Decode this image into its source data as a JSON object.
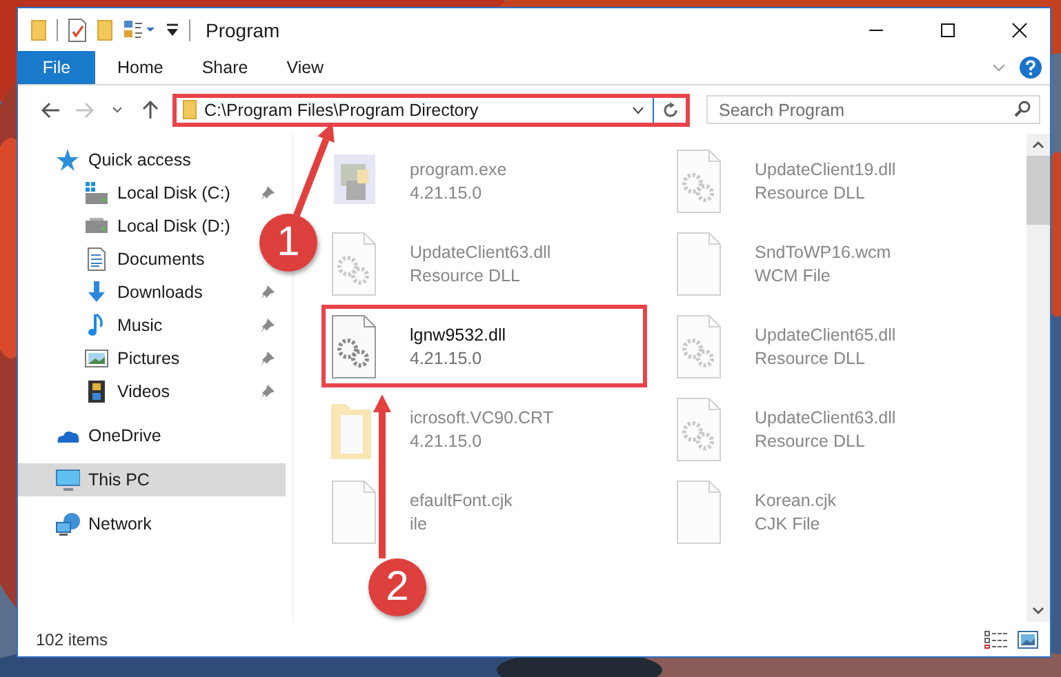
{
  "window": {
    "title": "Program"
  },
  "ribbon_tabs": [
    {
      "label": "File",
      "kind": "file"
    },
    {
      "label": "Home",
      "kind": "plain"
    },
    {
      "label": "Share",
      "kind": "plain"
    },
    {
      "label": "View",
      "kind": "plain"
    }
  ],
  "address_bar": {
    "path": "C:\\Program Files\\Program Directory",
    "highlighted": true
  },
  "search": {
    "placeholder": "Search Program"
  },
  "nav_items": [
    {
      "label": "Quick access",
      "kind": "star",
      "selected": false,
      "children": [
        {
          "label": "Local Disk (C:)",
          "kind": "systemdrive",
          "pinned": true,
          "selected": false
        },
        {
          "label": "Local Disk (D:)",
          "kind": "drive",
          "pinned": false,
          "selected": false
        },
        {
          "label": "Documents",
          "kind": "document",
          "pinned": false,
          "selected": false
        },
        {
          "label": "Downloads",
          "kind": "download",
          "pinned": true,
          "selected": false
        },
        {
          "label": "Music",
          "kind": "music",
          "pinned": true,
          "selected": false
        },
        {
          "label": "Pictures",
          "kind": "pictures",
          "pinned": true,
          "selected": false
        },
        {
          "label": "Videos",
          "kind": "film",
          "pinned": true,
          "selected": false
        }
      ]
    },
    {
      "label": "OneDrive",
      "kind": "cloud",
      "selected": false
    },
    {
      "label": "This PC",
      "kind": "monitor",
      "selected": true
    },
    {
      "label": "Network",
      "kind": "network",
      "selected": false
    }
  ],
  "files": [
    {
      "name": "program.exe",
      "detail": "4.21.15.0",
      "kind": "exe",
      "highlighted": false,
      "blurred": true
    },
    {
      "name": "UpdateClient19.dll",
      "detail": "Resource DLL",
      "kind": "gear",
      "highlighted": false,
      "blurred": true
    },
    {
      "name": "UpdateClient63.dll",
      "detail": "Resource DLL",
      "kind": "gear",
      "highlighted": false,
      "blurred": true
    },
    {
      "name": "SndToWP16.wcm",
      "detail": "WCM File",
      "kind": "blank",
      "highlighted": false,
      "blurred": true
    },
    {
      "name": "lgnw9532.dll",
      "detail": "4.21.15.0",
      "kind": "gear",
      "highlighted": true,
      "blurred": false
    },
    {
      "name": "UpdateClient65.dll",
      "detail": "Resource DLL",
      "kind": "gear",
      "highlighted": false,
      "blurred": true
    },
    {
      "name": "icrosoft.VC90.CRT",
      "detail": "4.21.15.0",
      "kind": "folder",
      "highlighted": false,
      "blurred": true
    },
    {
      "name": "UpdateClient63.dll",
      "detail": "Resource DLL",
      "kind": "gear",
      "highlighted": false,
      "blurred": true
    },
    {
      "name": "efaultFont.cjk",
      "detail": "ile",
      "kind": "blank",
      "highlighted": false,
      "blurred": true
    },
    {
      "name": "Korean.cjk",
      "detail": "CJK File",
      "kind": "blank",
      "highlighted": false,
      "blurred": true
    }
  ],
  "status_bar": {
    "item_count": "102 items"
  },
  "annotations": [
    {
      "number": "1"
    },
    {
      "number": "2"
    }
  ]
}
